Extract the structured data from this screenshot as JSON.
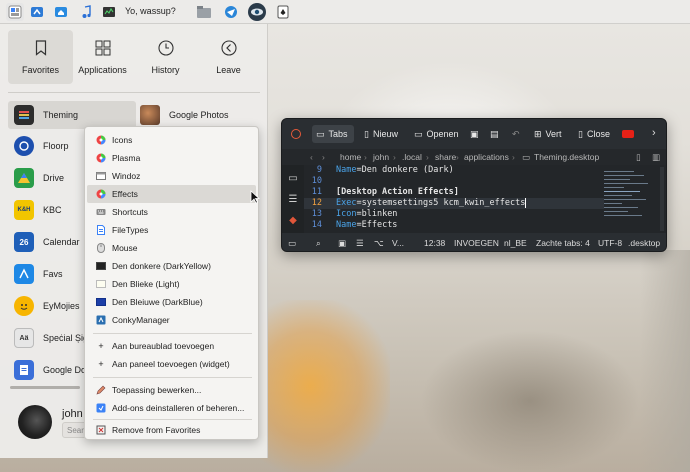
{
  "panel": {
    "text": "Yo, wassup?"
  },
  "launcher": {
    "tabs": [
      {
        "label": "Favorites",
        "icon": "bookmark-icon"
      },
      {
        "label": "Applications",
        "icon": "grid-icon"
      },
      {
        "label": "History",
        "icon": "clock-icon"
      },
      {
        "label": "Leave",
        "icon": "arrow-left-icon"
      }
    ],
    "favorites_left": [
      "Theming",
      "Floorp",
      "Drive",
      "KBC",
      "Calendar",
      "Favs",
      "EyMojies",
      "Speċial Șign",
      "Google Doc"
    ],
    "favorites_right": [
      "Google Photos"
    ],
    "calendar_day": "26",
    "kbc_badge": "K&H",
    "user": {
      "name": "john",
      "search_placeholder": "Sear"
    }
  },
  "context_menu": {
    "items": [
      "Icons",
      "Plasma",
      "Windoz",
      "Effects",
      "Shortcuts",
      "FileTypes",
      "Mouse",
      "Den donkere (DarkYellow)",
      "Den Blieke (Light)",
      "Den Bleiuwe (DarkBlue)",
      "ConkyManager"
    ],
    "actions": [
      "Aan bureaublad toevoegen",
      "Aan paneel toevoegen (widget)"
    ],
    "edit": [
      "Toepassing bewerken...",
      "Add-ons deinstalleren of beheren..."
    ],
    "remove": "Remove from Favorites",
    "highlighted": "Effects"
  },
  "editor": {
    "toolbar": {
      "tabs": "Tabs",
      "new": "Nieuw",
      "open": "Openen",
      "split": "Vert",
      "close": "Close"
    },
    "breadcrumb": [
      "home",
      "john",
      ".local",
      "share",
      "applications",
      "Theming.desktop"
    ],
    "lines": [
      {
        "n": "9",
        "key": "Name",
        "val": "=Den donkere (Dark)"
      },
      {
        "n": "10",
        "key": "",
        "val": ""
      },
      {
        "n": "11",
        "key": "",
        "val": "[Desktop Action Effects]"
      },
      {
        "n": "12",
        "key": "Exec",
        "val": "=systemsettings5 kcm_kwin_effects"
      },
      {
        "n": "13",
        "key": "Icon",
        "val": "=blinken"
      },
      {
        "n": "14",
        "key": "Name",
        "val": "=Effects"
      }
    ],
    "current_line": "12",
    "status": {
      "mode_short": "V...",
      "time": "12:38",
      "mode": "INVOEGEN",
      "lang": "nl_BE",
      "tabs": "Zachte tabs: 4",
      "encoding": "UTF-8",
      "ext": ".desktop"
    }
  },
  "colors": {
    "accent": "#3daee9",
    "editor_bg": "#232629",
    "keyword_blue": "#4aa3e8"
  }
}
